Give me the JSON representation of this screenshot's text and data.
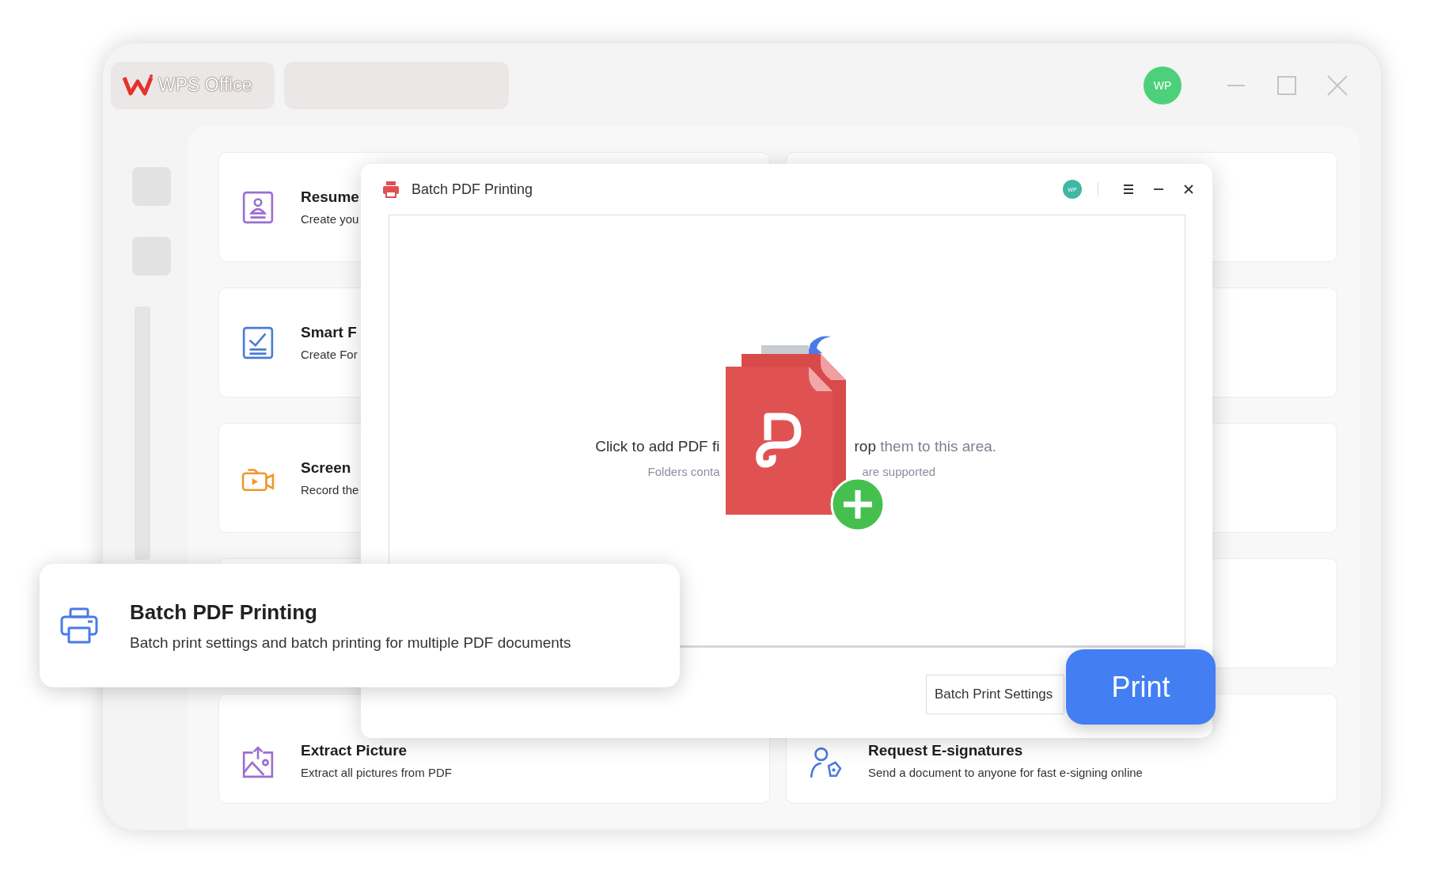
{
  "app": {
    "logo_text": "WPS Office",
    "avatar": "WP"
  },
  "cards": [
    {
      "kind": "resume",
      "title": "Resume",
      "desc": "Create you"
    },
    {
      "kind": "covered"
    },
    {
      "kind": "form",
      "title": "Smart F",
      "desc": "Create For"
    },
    {
      "kind": "covered"
    },
    {
      "kind": "record",
      "title": "Screen",
      "desc": "Record the"
    },
    {
      "kind": "covered"
    },
    {
      "kind": "covered"
    },
    {
      "kind": "covered"
    },
    {
      "kind": "picture",
      "title": "Extract Picture",
      "desc": "Extract all pictures from PDF"
    },
    {
      "kind": "signature",
      "title": "Request E-signatures",
      "desc": "Send a document to anyone for fast e-signing online"
    }
  ],
  "dialog": {
    "title": "Batch PDF Printing",
    "avatar": "WP",
    "hint_left": "Click to add PDF fi",
    "hint_right_dark": "rop",
    "hint_right_grey": "them to this area.",
    "note_left": "Folders conta",
    "note_right": "are supported",
    "settings_button": "Batch Print Settings",
    "print_button": "Print"
  },
  "callout": {
    "title": "Batch PDF Printing",
    "desc": "Batch print settings and batch printing for multiple PDF documents"
  }
}
